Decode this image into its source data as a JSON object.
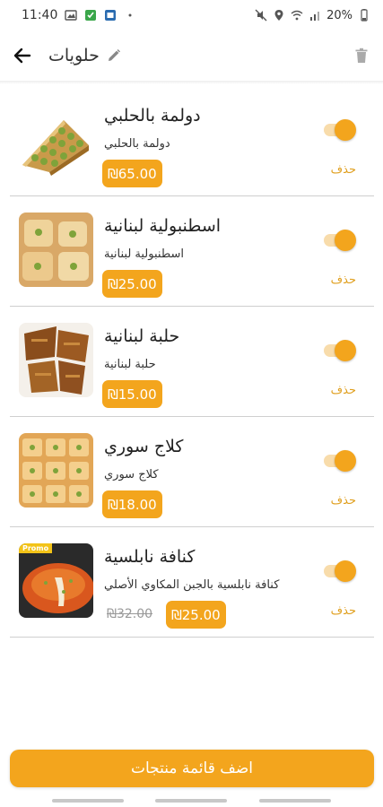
{
  "status_bar": {
    "time": "11:40",
    "battery": "20%"
  },
  "app_bar": {
    "title": "حلويات"
  },
  "items": [
    {
      "name": "دولمة بالحلبي",
      "description": "دولمة بالحلبي",
      "price": "₪65.00",
      "old_price": "",
      "delete_label": "حذف",
      "enabled": true,
      "image": "baklava-dolma"
    },
    {
      "name": "اسطنبولية لبنانية",
      "description": "اسطنبولية لبنانية",
      "price": "₪25.00",
      "old_price": "",
      "delete_label": "حذف",
      "enabled": true,
      "image": "istanbuliya"
    },
    {
      "name": "حلبة لبنانية",
      "description": "حلبة لبنانية",
      "price": "₪15.00",
      "old_price": "",
      "delete_label": "حذف",
      "enabled": true,
      "image": "helba"
    },
    {
      "name": "كلاج سوري",
      "description": "كلاج سوري",
      "price": "₪18.00",
      "old_price": "",
      "delete_label": "حذف",
      "enabled": true,
      "image": "kallaj"
    },
    {
      "name": "كنافة نابلسية",
      "description": "كنافة نابلسية بالجبن المكاوي الأصلي",
      "price": "₪25.00",
      "old_price": "₪32.00",
      "delete_label": "حذف",
      "enabled": true,
      "image": "knafeh",
      "badge": "Promo"
    }
  ],
  "footer": {
    "button_label": "اضف قائمة منتجات"
  },
  "colors": {
    "accent": "#f3a51d",
    "accent_light": "#f8dcab",
    "delete_text": "#e0a020"
  }
}
